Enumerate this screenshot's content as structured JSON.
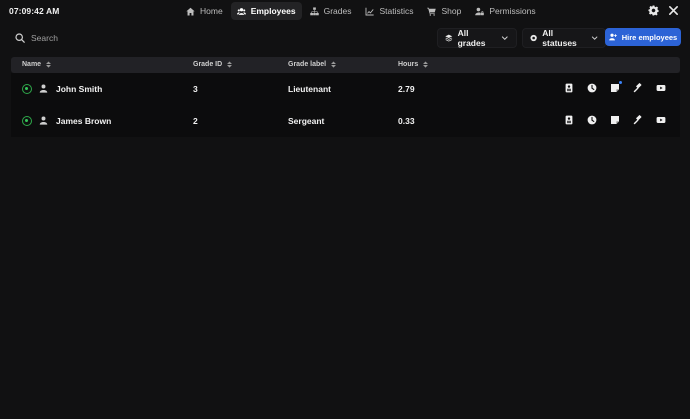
{
  "clock": "07:09:42 AM",
  "nav": {
    "items": [
      {
        "label": "Home",
        "icon": "home-icon",
        "active": false
      },
      {
        "label": "Employees",
        "icon": "users-icon",
        "active": true
      },
      {
        "label": "Grades",
        "icon": "hierarchy-icon",
        "active": false
      },
      {
        "label": "Statistics",
        "icon": "chart-line-icon",
        "active": false
      },
      {
        "label": "Shop",
        "icon": "cart-icon",
        "active": false
      },
      {
        "label": "Permissions",
        "icon": "user-lock-icon",
        "active": false
      }
    ]
  },
  "toolbar": {
    "search_placeholder": "Search",
    "grades_filter": "All grades",
    "status_filter": "All statuses",
    "hire_label": "Hire employees"
  },
  "table": {
    "columns": [
      "Name",
      "Grade ID",
      "Grade label",
      "Hours"
    ],
    "rows": [
      {
        "name": "John Smith",
        "grade_id": "3",
        "grade_label": "Lieutenant",
        "hours": "2.79",
        "status": "online",
        "note_badge": true
      },
      {
        "name": "James Brown",
        "grade_id": "2",
        "grade_label": "Sergeant",
        "hours": "0.33",
        "status": "online",
        "note_badge": false
      }
    ]
  },
  "colors": {
    "accent": "#2c63d6",
    "online": "#34c759",
    "background": "#111112"
  }
}
